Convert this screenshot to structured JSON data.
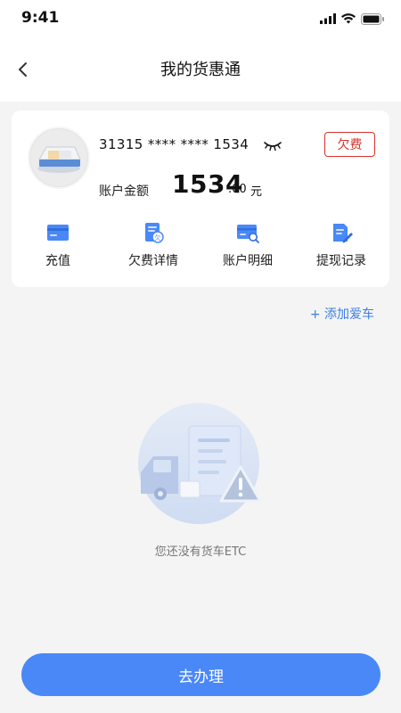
{
  "status_bar": {
    "time": "9:41"
  },
  "nav": {
    "title": "我的货惠通"
  },
  "card": {
    "number": "31315 **** **** 1534",
    "badge": "欠费",
    "balance_label": "账户金额",
    "balance_integer": "1534",
    "balance_decimal": ".00",
    "balance_unit": "元"
  },
  "actions": [
    {
      "label": "充值",
      "icon": "card-icon"
    },
    {
      "label": "欠费详情",
      "icon": "bill-icon"
    },
    {
      "label": "账户明细",
      "icon": "card-search-icon"
    },
    {
      "label": "提现记录",
      "icon": "document-edit-icon"
    }
  ],
  "add_car": {
    "label": "+ 添加爱车"
  },
  "empty_state": {
    "text": "您还没有货车ETC"
  },
  "cta": {
    "label": "去办理"
  },
  "colors": {
    "accent": "#4a88f7",
    "badge": "#d8322a",
    "link": "#3d7fe8",
    "background": "#f4f4f4"
  }
}
